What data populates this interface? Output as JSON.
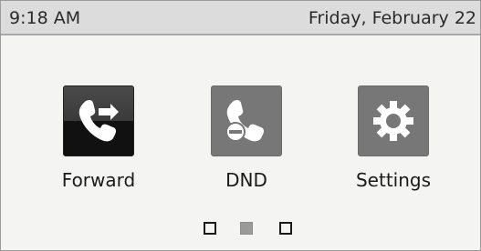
{
  "status_bar": {
    "time": "9:18 AM",
    "date": "Friday, February 22"
  },
  "apps": [
    {
      "label": "Forward",
      "icon": "call-forward-icon"
    },
    {
      "label": "DND",
      "icon": "do-not-disturb-icon"
    },
    {
      "label": "Settings",
      "icon": "gear-icon"
    }
  ],
  "pager": {
    "page_count": 3,
    "current_page": 2
  },
  "colors": {
    "background": "#f4f4f2",
    "status_bar": "#dcdcdc",
    "icon_grey": "#777777",
    "icon_dark": "#111111",
    "active_dot": "#9a9a9a"
  }
}
